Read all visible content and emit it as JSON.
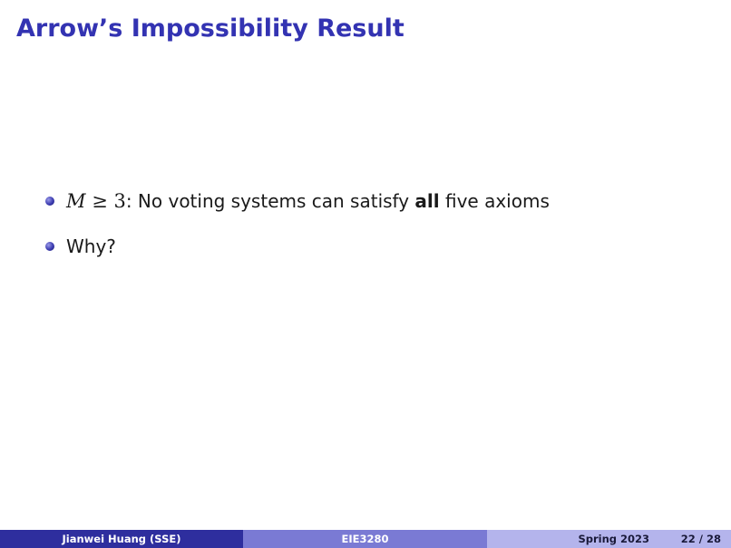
{
  "slide": {
    "title": "Arrow’s Impossibility Result",
    "bullets": [
      {
        "math_var": "M",
        "math_rel": " ≥ 3",
        "after_math": ": No voting systems can satisfy ",
        "emphasis": "all",
        "tail": " five axioms"
      },
      {
        "text": "Why?"
      }
    ]
  },
  "footer": {
    "author": "Jianwei Huang  (SSE)",
    "course": "EIE3280",
    "date": "Spring 2023",
    "page": "22 / 28"
  },
  "colors": {
    "title": "#3333b2",
    "footer_left": "#2e2e9e",
    "footer_mid": "#7a7ad4",
    "footer_right": "#b4b4ec",
    "bullet": "#3b3bb0"
  }
}
